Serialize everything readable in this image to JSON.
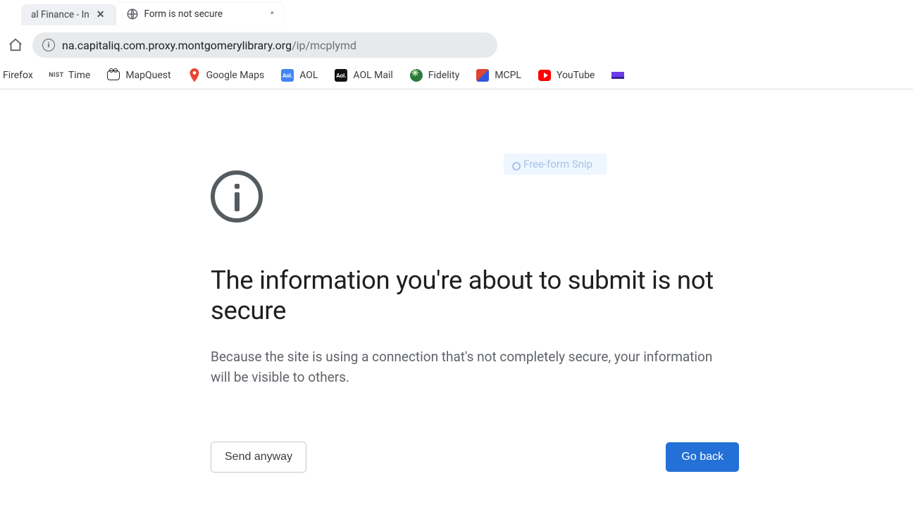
{
  "tabs": {
    "inactive_title": "al Finance - In",
    "active_title": "Form is not secure"
  },
  "omnibox": {
    "host": "na.capitaliq.com.proxy.montgomerylibrary.org",
    "path": "/ip/mcplymd"
  },
  "bookmarks": [
    {
      "label": "Firefox"
    },
    {
      "label": "Time"
    },
    {
      "label": "MapQuest"
    },
    {
      "label": "Google Maps"
    },
    {
      "label": "AOL"
    },
    {
      "label": "AOL Mail"
    },
    {
      "label": "Fidelity"
    },
    {
      "label": "MCPL"
    },
    {
      "label": "YouTube"
    }
  ],
  "snip_label": "Free-form Snip",
  "interstitial": {
    "headline": "The information you're about to submit is not secure",
    "body": "Because the site is using a connection that's not completely secure, your information will be visible to others.",
    "send_label": "Send anyway",
    "back_label": "Go back"
  }
}
